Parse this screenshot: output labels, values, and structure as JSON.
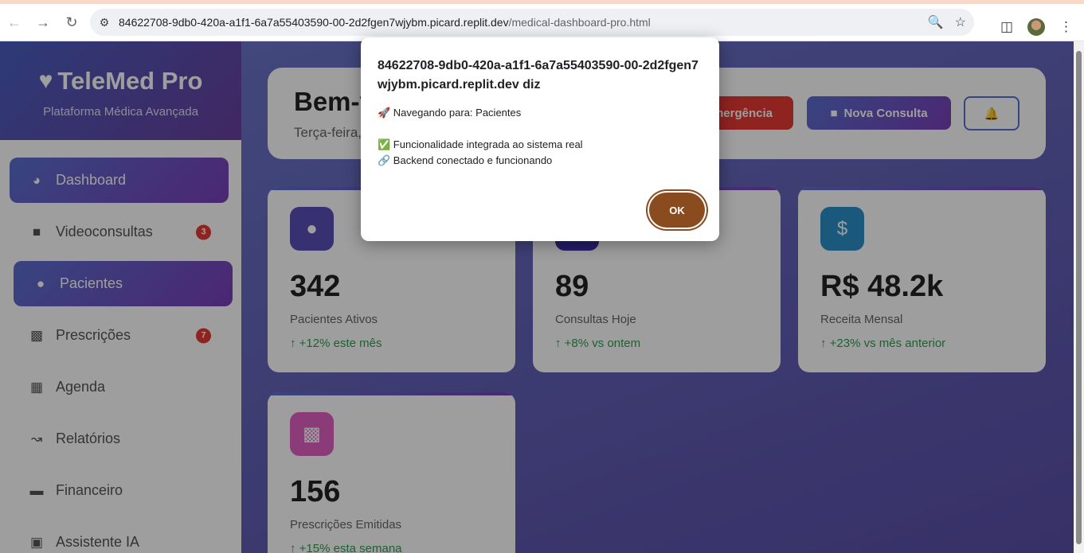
{
  "browser": {
    "url_host": "84622708-9db0-420a-a1f1-6a7a55403590-00-2d2fgen7wjybm.picard.replit.dev",
    "url_path": "/medical-dashboard-pro.html"
  },
  "sidebar": {
    "logo": "TeleMed Pro",
    "subtitle": "Plataforma Médica Avançada",
    "items": [
      {
        "label": "Dashboard",
        "icon": "gauge-icon"
      },
      {
        "label": "Videoconsultas",
        "icon": "video-icon",
        "badge": "3"
      },
      {
        "label": "Pacientes",
        "icon": "users-icon"
      },
      {
        "label": "Prescrições",
        "icon": "prescription-icon",
        "badge": "7"
      },
      {
        "label": "Agenda",
        "icon": "calendar-icon"
      },
      {
        "label": "Relatórios",
        "icon": "chart-line-icon"
      },
      {
        "label": "Financeiro",
        "icon": "credit-card-icon"
      },
      {
        "label": "Assistente IA",
        "icon": "robot-icon"
      }
    ]
  },
  "header": {
    "welcome": "Bem-v",
    "date": "Terça-feira,",
    "emergency_label": "mergência",
    "new_consult_label": "Nova Consulta"
  },
  "stats": [
    {
      "value": "342",
      "label": "Pacientes Ativos",
      "change": "+12% este mês",
      "icon": "users-icon",
      "color": "#5a4fb8"
    },
    {
      "value": "89",
      "label": "Consultas Hoje",
      "change": "+8% vs ontem",
      "icon": "video-icon",
      "color": "#3a2fa8"
    },
    {
      "value": "R$ 48.2k",
      "label": "Receita Mensal",
      "change": "+23% vs mês anterior",
      "icon": "dollar-icon",
      "color": "#2a8fc8"
    },
    {
      "value": "156",
      "label": "Prescrições Emitidas",
      "change": "+15% esta semana",
      "icon": "prescription-bottle-icon",
      "color": "#e060c0"
    }
  ],
  "dialog": {
    "title": "84622708-9db0-420a-a1f1-6a7a55403590-00-2d2fgen7wjybm.picard.replit.dev diz",
    "line1": "🚀 Navegando para: Pacientes",
    "line2": "✅ Funcionalidade integrada ao sistema real",
    "line3": "🔗 Backend conectado e funcionando",
    "ok_label": "OK"
  }
}
